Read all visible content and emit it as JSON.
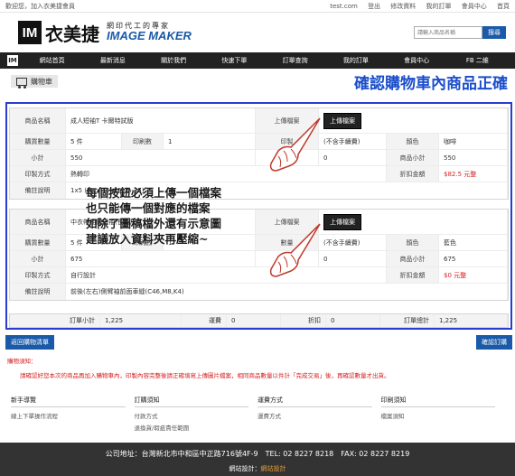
{
  "topbar": {
    "greeting": "歡迎您，加入衣美捷會員",
    "links": [
      "test.com",
      "登出",
      "修改資料",
      "我的訂單",
      "會員中心",
      "首頁"
    ]
  },
  "header": {
    "logo_mark": "IM",
    "logo_cn": "衣美捷",
    "logo_sub": "網印代工的專家",
    "logo_en": "IMAGE MAKER",
    "search_placeholder": "請輸入商品名稱",
    "search_button": "搜尋"
  },
  "nav": {
    "home": "IM",
    "items": [
      "網站首頁",
      "最新消息",
      "關於我們",
      "快速下單",
      "訂單查詢",
      "我的訂單",
      "會員中心",
      "FB 二維"
    ]
  },
  "page": {
    "cart_label": "購物車",
    "annotation_title": "確認購物車內商品正確"
  },
  "items": [
    {
      "name_label": "商品名稱",
      "name": "成人短袖T 卡爾特試版",
      "upload_label": "上傳檔案",
      "upload_button": "上傳檔案",
      "qty_label": "購買數量",
      "qty": "5 件",
      "pcs_label": "印刷數",
      "pcs": "1",
      "print_label": "印製",
      "print": "(不含手續費)",
      "w": "0",
      "d_label": "顏色",
      "d": "咖啡",
      "subtotal_label": "小計",
      "subtotal": "550",
      "extra": "0",
      "goods_label": "商品小計",
      "goods": "550",
      "print_method_label": "印製方式",
      "print_method": "熱轉印",
      "discount_label": "折扣金額",
      "discount": "$82.5 元整",
      "remark_label": "備註說明",
      "remark": "1x5 (Max 45x45cm-35)"
    },
    {
      "name_label": "商品名稱",
      "name": "中衣帶抽帽短袖(長版尺寸)",
      "upload_label": "上傳檔案",
      "upload_button": "上傳檔案",
      "qty_label": "購買數量",
      "qty": "5 件",
      "pcs_label": "印刷數",
      "pcs": "1",
      "print_label": "數量",
      "print": "(不含手續費)",
      "w": "0",
      "d_label": "顏色",
      "d": "藍色",
      "subtotal_label": "小計",
      "subtotal": "675",
      "extra": "0",
      "goods_label": "商品小計",
      "goods": "675",
      "print_method_label": "印製方式",
      "print_method": "自行設計",
      "discount_label": "折扣金額",
      "discount": "$0 元整",
      "remark_label": "備註說明",
      "remark": "前後(左右)側臂袖前面車縫(C46,M8,K4)"
    }
  ],
  "totals": {
    "subtotal_label": "訂單小計",
    "subtotal": "1,225",
    "ship_label": "運費",
    "ship": "0",
    "fee_label": "折扣",
    "fee": "0",
    "total_label": "訂單總計",
    "total": "1,225"
  },
  "actions": {
    "back": "返回購物清單",
    "checkout": "確認訂購"
  },
  "notice": {
    "title": "購物須知：",
    "body": "請確認好您本次的商品再加入購物車內，印製內容完整後請正確填寫上傳圖片檔案，相同商品數量以件計「完成交易」後，再確認數量才出貨。"
  },
  "overlay": {
    "lines": [
      "每個按鈕必須上傳一個檔案",
      "也只能傳一個對應的檔案",
      "如除了圖稿檔外還有示意圖",
      "建議放入資料夾再壓縮~"
    ]
  },
  "footer_links": [
    {
      "head": "新手導覽",
      "items": [
        "線上下單操作流程"
      ]
    },
    {
      "head": "訂購須知",
      "items": [
        "付款方式",
        "退換貨/瑕疵責任範圍"
      ]
    },
    {
      "head": "運費方式",
      "items": [
        "運費方式"
      ]
    },
    {
      "head": "印刷須知",
      "items": [
        "檔案須知"
      ]
    }
  ],
  "footer": {
    "address": "公司地址：台灣新北市中和區中正路716號4F-9　TEL: 02 8227 8218　FAX: 02 8227 8219",
    "credit_label": "網站設計：",
    "credit": "網站設計"
  }
}
